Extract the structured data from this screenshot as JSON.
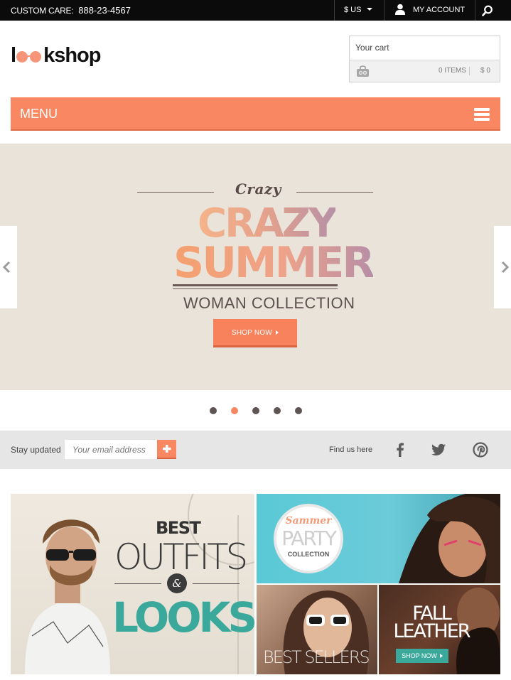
{
  "topbar": {
    "care_label": "CUSTOM CARE:",
    "phone": "888-23-4567",
    "currency": "$ US",
    "account_label": "MY ACCOUNT"
  },
  "header": {
    "logo_text": "kshop",
    "cart": {
      "title": "Your cart",
      "items": "0 ITEMS",
      "total": "$ 0"
    }
  },
  "menu": {
    "label": "MENU"
  },
  "slider": {
    "script": "Crazy",
    "title_line1": "CRAZY",
    "title_line2": "SUMMER",
    "subtitle": "WOMAN COLLECTION",
    "button": "SHOP NOW",
    "slide_count": 5,
    "active_slide": 2
  },
  "newsletter": {
    "label": "Stay updated",
    "placeholder": "Your email address",
    "find_us": "Find us here",
    "social": [
      "facebook-icon",
      "twitter-icon",
      "pinterest-icon"
    ]
  },
  "promos": {
    "outfits": {
      "best": "BEST",
      "outfits": "OUTFITS",
      "amp": "&",
      "looks": "LOOKS"
    },
    "party": {
      "script": "Sammer",
      "big": "PARTY",
      "small": "COLLECTION"
    },
    "bestsellers": {
      "label": "BEST SELLERS"
    },
    "fall": {
      "line1": "FALL",
      "line2": "LEATHER",
      "button": "SHOP NOW"
    }
  },
  "colors": {
    "accent": "#f88762",
    "topbar": "#0b0b0b",
    "slider_bg": "#e9e3da",
    "teal": "#3aa89a"
  }
}
